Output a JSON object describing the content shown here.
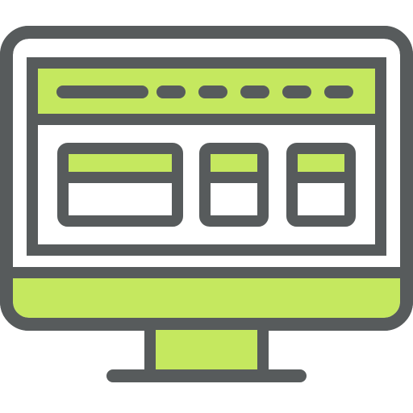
{
  "icon": {
    "name": "desktop-website-icon",
    "colors": {
      "outline": "#575b5c",
      "accent": "#c5e85f",
      "fill": "#ffffff"
    }
  }
}
